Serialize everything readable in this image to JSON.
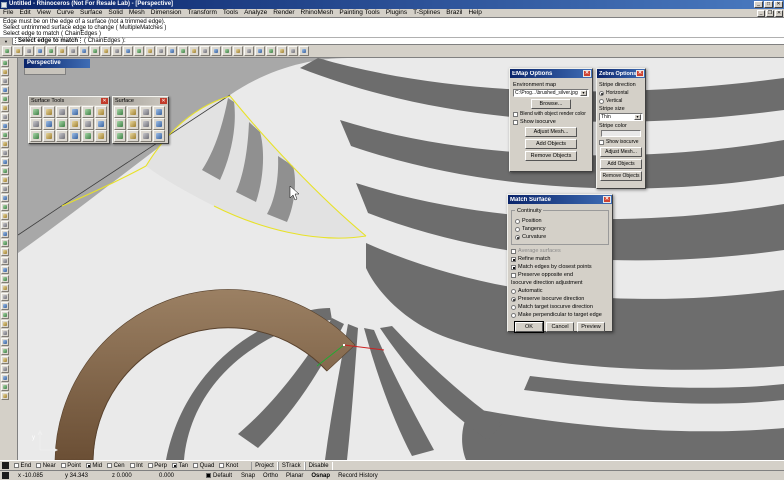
{
  "window": {
    "title": "Untitled - Rhinoceros (Not For Resale Lab) - [Perspective]"
  },
  "menu": {
    "items": [
      "File",
      "Edit",
      "View",
      "Curve",
      "Surface",
      "Solid",
      "Mesh",
      "Dimension",
      "Transform",
      "Tools",
      "Analyze",
      "Render",
      "RhinoMesh",
      "Painting Tools",
      "Plugins",
      "T-Splines",
      "Brazil",
      "Help"
    ]
  },
  "command_area": {
    "history": [
      "Edge must be on the edge of a surface (not a trimmed edge).",
      "Select untrimmed surface edge to change ( MultipleMatches )",
      "Select edge to match ( ChainEdges )"
    ],
    "prompt": "Select edge to match",
    "prompt_options": "( ChainEdges ):"
  },
  "toolbar": {
    "icons": [
      "new-file",
      "open-file",
      "save-file",
      "print",
      "cut",
      "copy-to-clipboard",
      "paste",
      "undo",
      "redo",
      "delete",
      "select-all",
      "zoom-window",
      "zoom-extents",
      "zoom-selected",
      "pan-view",
      "rotate-view",
      "named-views",
      "move",
      "copy-object",
      "rotate",
      "scale",
      "mirror",
      "join",
      "explode",
      "trim",
      "split",
      "object-properties",
      "help"
    ]
  },
  "left_toolbar": {
    "icons": [
      "pointer",
      "point",
      "polyline",
      "curve",
      "circle",
      "arc",
      "ellipse",
      "rectangle",
      "polygon",
      "line",
      "helix",
      "text",
      "surface-3pt",
      "plane",
      "loft",
      "revolve",
      "sweep-1",
      "sweep-2",
      "box",
      "sphere",
      "cylinder",
      "cone",
      "torus",
      "pipe",
      "mesh-box",
      "join",
      "explode",
      "trim",
      "split",
      "extend",
      "fillet",
      "chamfer",
      "offset",
      "move",
      "copy",
      "rotate",
      "scale",
      "mirror"
    ]
  },
  "viewport": {
    "label": "Perspective",
    "axis_label": "y"
  },
  "palettes": {
    "surface_tools": {
      "title": "Surface Tools",
      "icons": [
        "fillet-surface",
        "chamfer-surface",
        "extend-surface",
        "blend-surface",
        "match-surface",
        "merge-surfaces",
        "join-surfaces",
        "untrim-surface",
        "split-surface",
        "trim-surface",
        "rebuild-surface",
        "change-surface-degree",
        "insert-knot",
        "remove-knot",
        "shrink-trimmed-surface",
        "offset-surface",
        "variable-radius-fillet",
        "connect-surfaces"
      ]
    },
    "surface": {
      "title": "Surface",
      "icons": [
        "surface-from-3-points",
        "surface-from-edge-curves",
        "loft",
        "extrude-curve",
        "revolve",
        "rail-revolve",
        "sweep-1-rail",
        "sweep-2-rails",
        "surface-from-network",
        "patch",
        "drape",
        "plane-through-points"
      ]
    }
  },
  "dialogs": {
    "emap": {
      "title": "EMap Options",
      "env_label": "Environment map",
      "map_value": "C:\\Prog...\\brushed_silver.jpg",
      "browse": "Browse...",
      "blend_label": "Blend with object render color",
      "show_isocurve": "Show isocurve",
      "adjust_mesh": "Adjust Mesh...",
      "add_objects": "Add Objects",
      "remove_objects": "Remove Objects"
    },
    "zebra": {
      "title": "Zebra Options",
      "stripe_direction": "Stripe direction",
      "horizontal": "Horizontal",
      "vertical": "Vertical",
      "stripe_size": "Stripe size",
      "size_value": "Thin",
      "stripe_color": "Stripe color",
      "show_isocurve": "Show isocurve",
      "adjust_mesh": "Adjust Mesh...",
      "add_objects": "Add Objects",
      "remove_objects": "Remove Objects"
    },
    "match": {
      "title": "Match Surface",
      "continuity": "Continuity",
      "position": "Position",
      "tangency": "Tangency",
      "curvature": "Curvature",
      "average": "Average surfaces",
      "refine": "Refine match",
      "closest": "Match edges by closest points",
      "preserve_end": "Preserve opposite end",
      "iso_group": "Isocurve direction adjustment",
      "automatic": "Automatic",
      "preserve_iso": "Preserve isocurve direction",
      "match_target": "Match target isocurve direction",
      "perpendicular": "Make perpendicular to target edge",
      "ok": "OK",
      "cancel": "Cancel",
      "preview": "Preview"
    }
  },
  "status": {
    "osnaps": [
      {
        "label": "End",
        "checked": false
      },
      {
        "label": "Near",
        "checked": false
      },
      {
        "label": "Point",
        "checked": false
      },
      {
        "label": "Mid",
        "checked": true
      },
      {
        "label": "Cen",
        "checked": false
      },
      {
        "label": "Int",
        "checked": false
      },
      {
        "label": "Perp",
        "checked": false
      },
      {
        "label": "Tan",
        "checked": true
      },
      {
        "label": "Quad",
        "checked": false
      },
      {
        "label": "Knot",
        "checked": false
      }
    ],
    "osnap_buttons": [
      "Project",
      "STrack",
      "Disable"
    ],
    "coords": {
      "x": "x -10.085",
      "y": "y 34.343",
      "z": "z 0.000",
      "units": "0.000"
    },
    "layer": "Default",
    "toggles": [
      {
        "label": "Snap",
        "active": false
      },
      {
        "label": "Ortho",
        "active": false
      },
      {
        "label": "Planar",
        "active": false
      },
      {
        "label": "Osnap",
        "active": true
      },
      {
        "label": "Record History",
        "active": false
      }
    ]
  },
  "colors": {
    "titlebar": "#0a246a",
    "chrome": "#d4d0c8",
    "selection_edge": "#e8e228",
    "ring_brown": "#8a6f52",
    "stripe_dark": "#6d6d6d",
    "stripe_light": "#eaeaea"
  }
}
